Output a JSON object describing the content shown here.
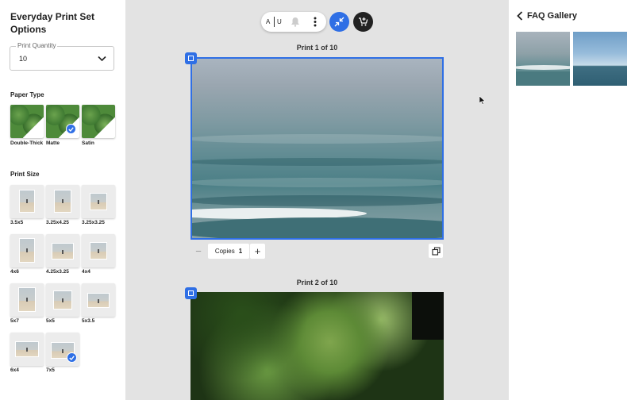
{
  "left_panel": {
    "title": "Everyday Print Set Options",
    "quantity": {
      "label": "Print Quantity",
      "value": "10"
    },
    "paper_type": {
      "heading": "Paper Type",
      "options": [
        {
          "label": "Double-Thick",
          "selected": false
        },
        {
          "label": "Matte",
          "selected": true
        },
        {
          "label": "Satin",
          "selected": false
        }
      ]
    },
    "print_size": {
      "heading": "Print Size",
      "options": [
        {
          "label": "3.5x5",
          "selected": false
        },
        {
          "label": "3.25x4.25",
          "selected": false
        },
        {
          "label": "3.25x3.25",
          "selected": false
        },
        {
          "label": "4x6",
          "selected": false
        },
        {
          "label": "4.25x3.25",
          "selected": false
        },
        {
          "label": "4x4",
          "selected": false
        },
        {
          "label": "5x7",
          "selected": false
        },
        {
          "label": "5x5",
          "selected": false
        },
        {
          "label": "5x3.5",
          "selected": false
        },
        {
          "label": "6x4",
          "selected": false
        },
        {
          "label": "7x5",
          "selected": true
        }
      ]
    }
  },
  "toolbar": {
    "font_a": "A",
    "font_u": "U",
    "icons": [
      "bell-icon",
      "more-vertical-icon",
      "collapse-arrows-icon",
      "cart-add-icon"
    ],
    "accent_color": "#2f6fe5"
  },
  "prints": [
    {
      "title": "Print 1 of 10",
      "copies_label": "Copies",
      "copies_value": "1"
    },
    {
      "title": "Print 2 of 10"
    }
  ],
  "right_panel": {
    "title": "FAQ Gallery",
    "back_icon": "chevron-left-icon"
  }
}
